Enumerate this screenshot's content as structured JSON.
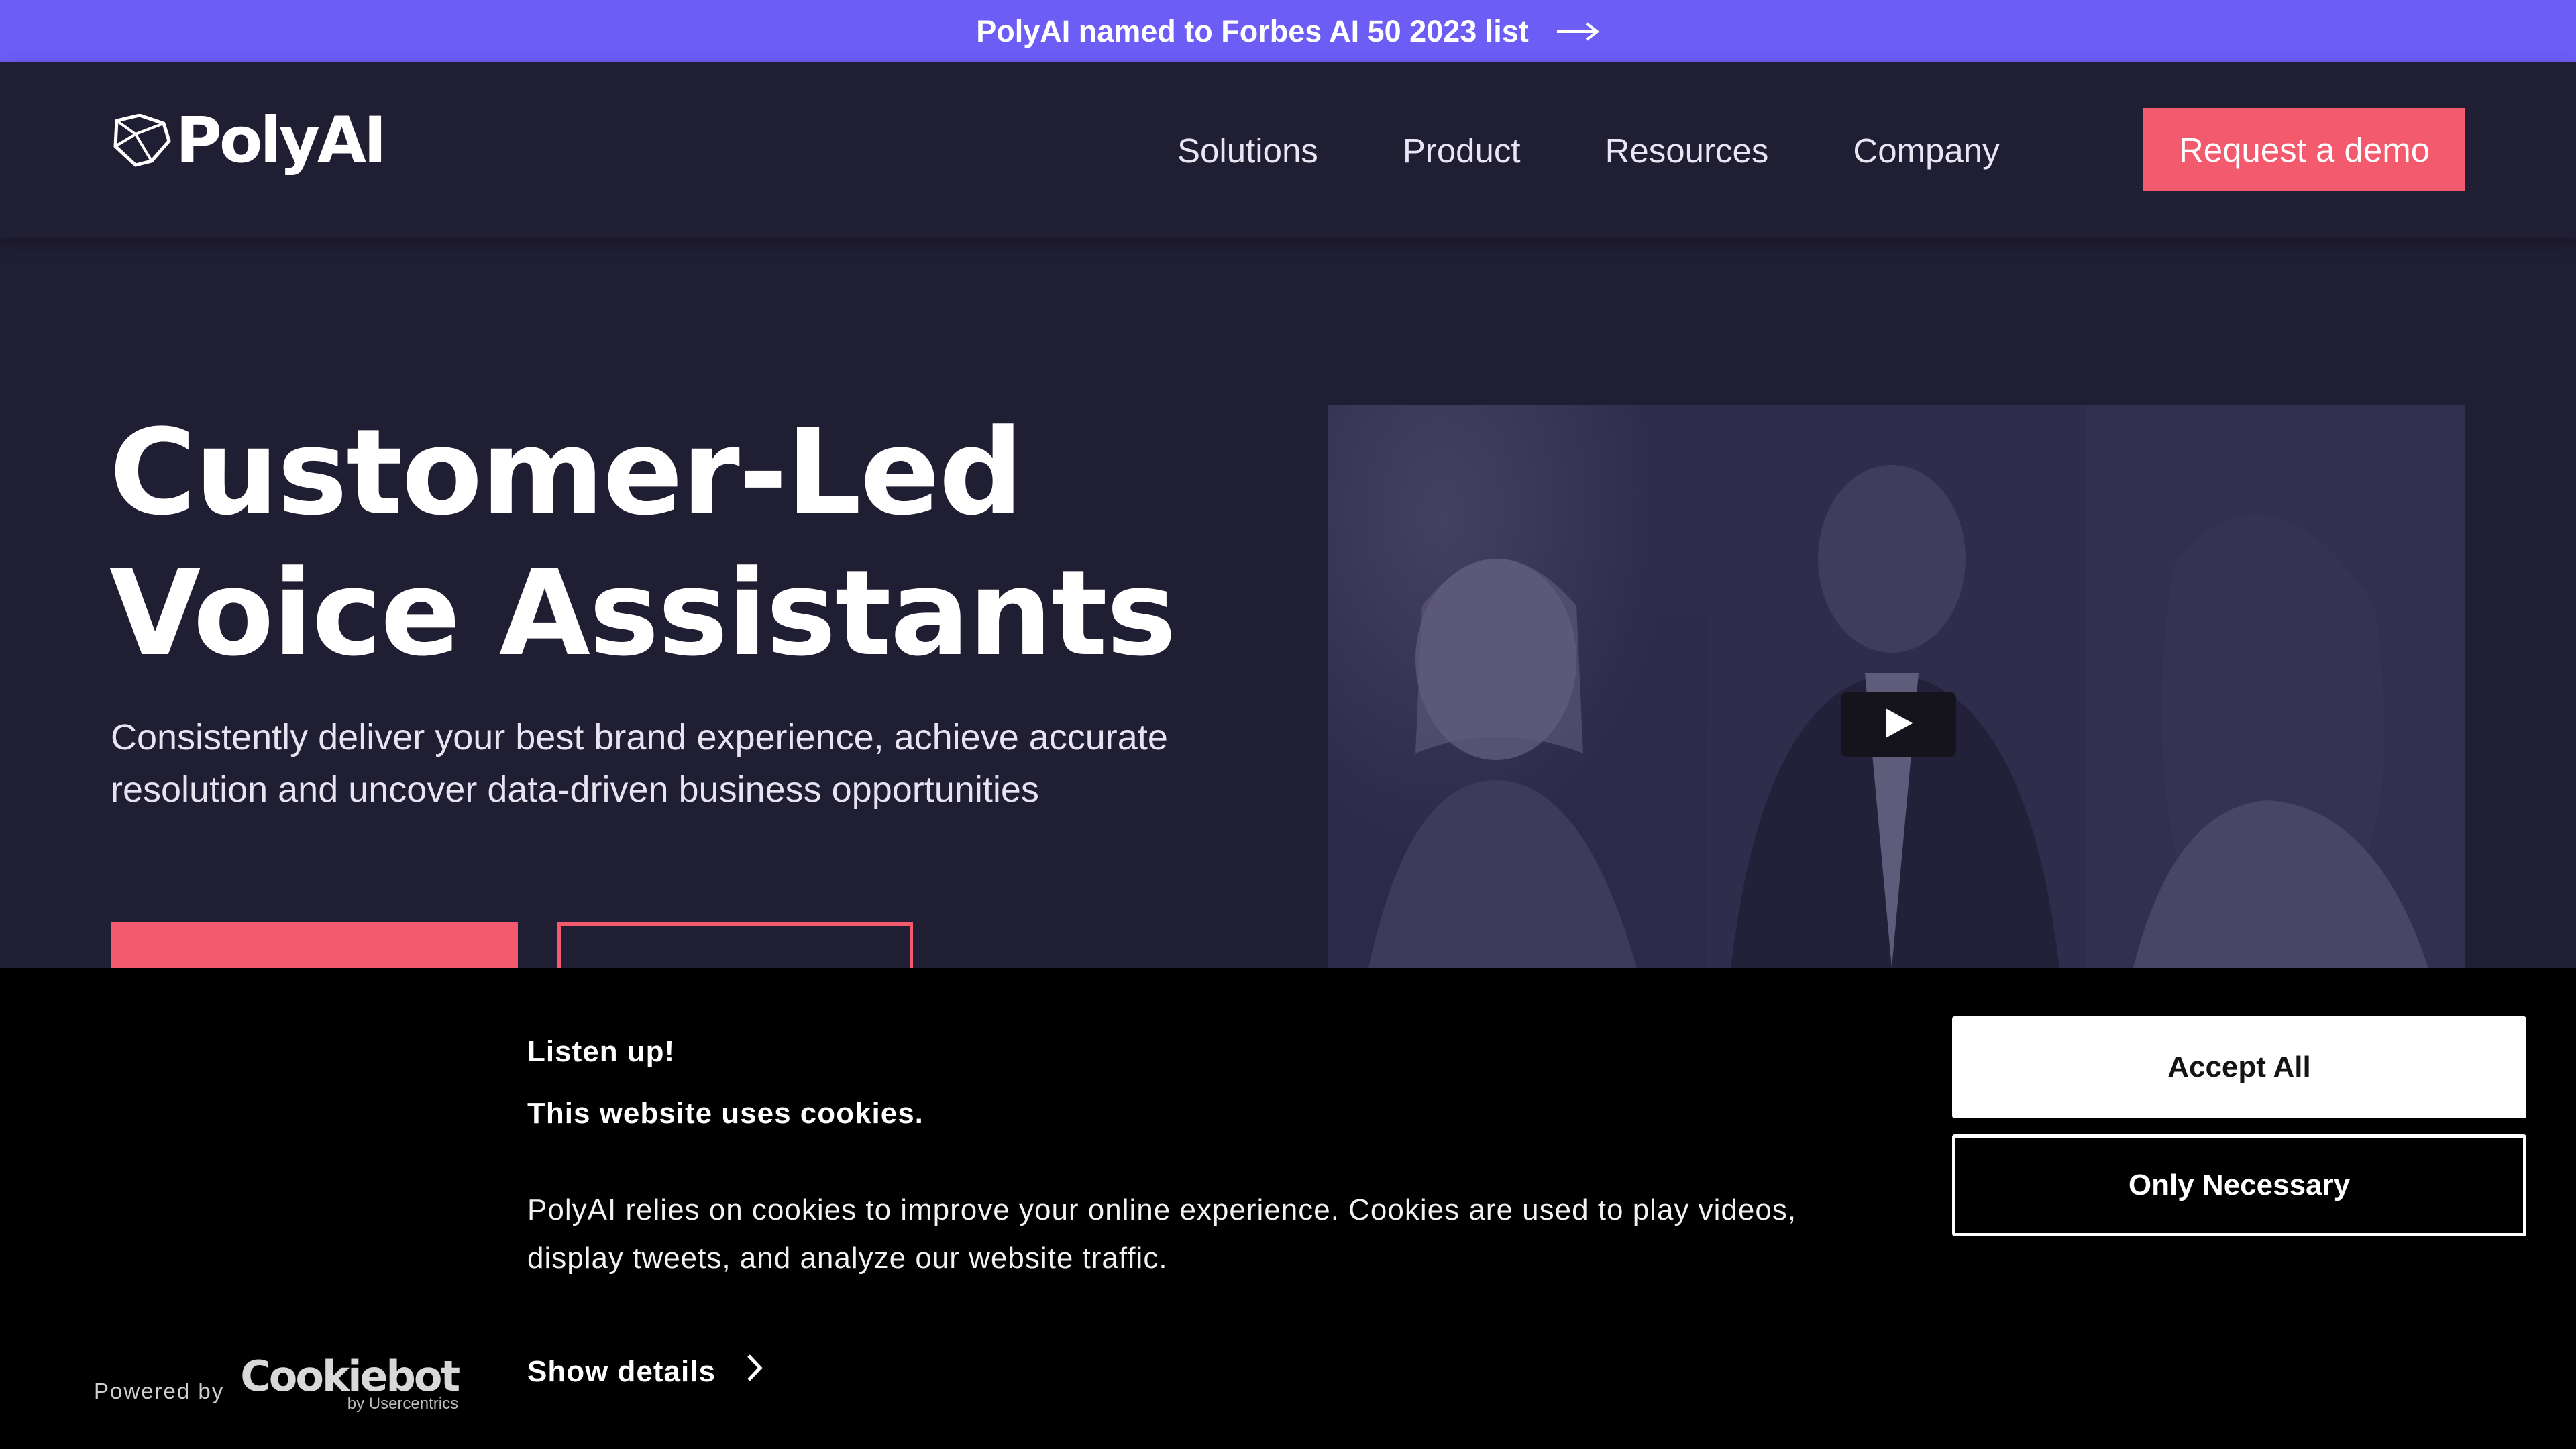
{
  "announcement": {
    "text": "PolyAI named to Forbes AI 50 2023 list",
    "icon": "arrow-right-icon"
  },
  "header": {
    "logo_text": "PolyAI",
    "nav": [
      {
        "label": "Solutions"
      },
      {
        "label": "Product"
      },
      {
        "label": "Resources"
      },
      {
        "label": "Company"
      }
    ],
    "cta_label": "Request a demo"
  },
  "hero": {
    "title_line1": "Customer-Led",
    "title_line2": "Voice Assistants",
    "subtitle": "Consistently deliver your best brand experience, achieve accurate resolution and uncover data-driven business opportunities",
    "video": {
      "play_icon": "play-icon"
    }
  },
  "cookie_banner": {
    "heading": "Listen up!",
    "subheading": "This website uses cookies.",
    "body": "PolyAI relies on cookies to improve your online experience. Cookies are used to play videos, display tweets, and analyze our website traffic.",
    "show_details_label": "Show details",
    "powered_by_label": "Powered by",
    "provider_name": "Cookiebot",
    "provider_sub": "by Usercentrics",
    "accept_label": "Accept All",
    "necessary_label": "Only Necessary"
  },
  "colors": {
    "accent": "#6c5ef5",
    "cta": "#f45a6e",
    "background": "#201e33",
    "banner": "#000000"
  }
}
